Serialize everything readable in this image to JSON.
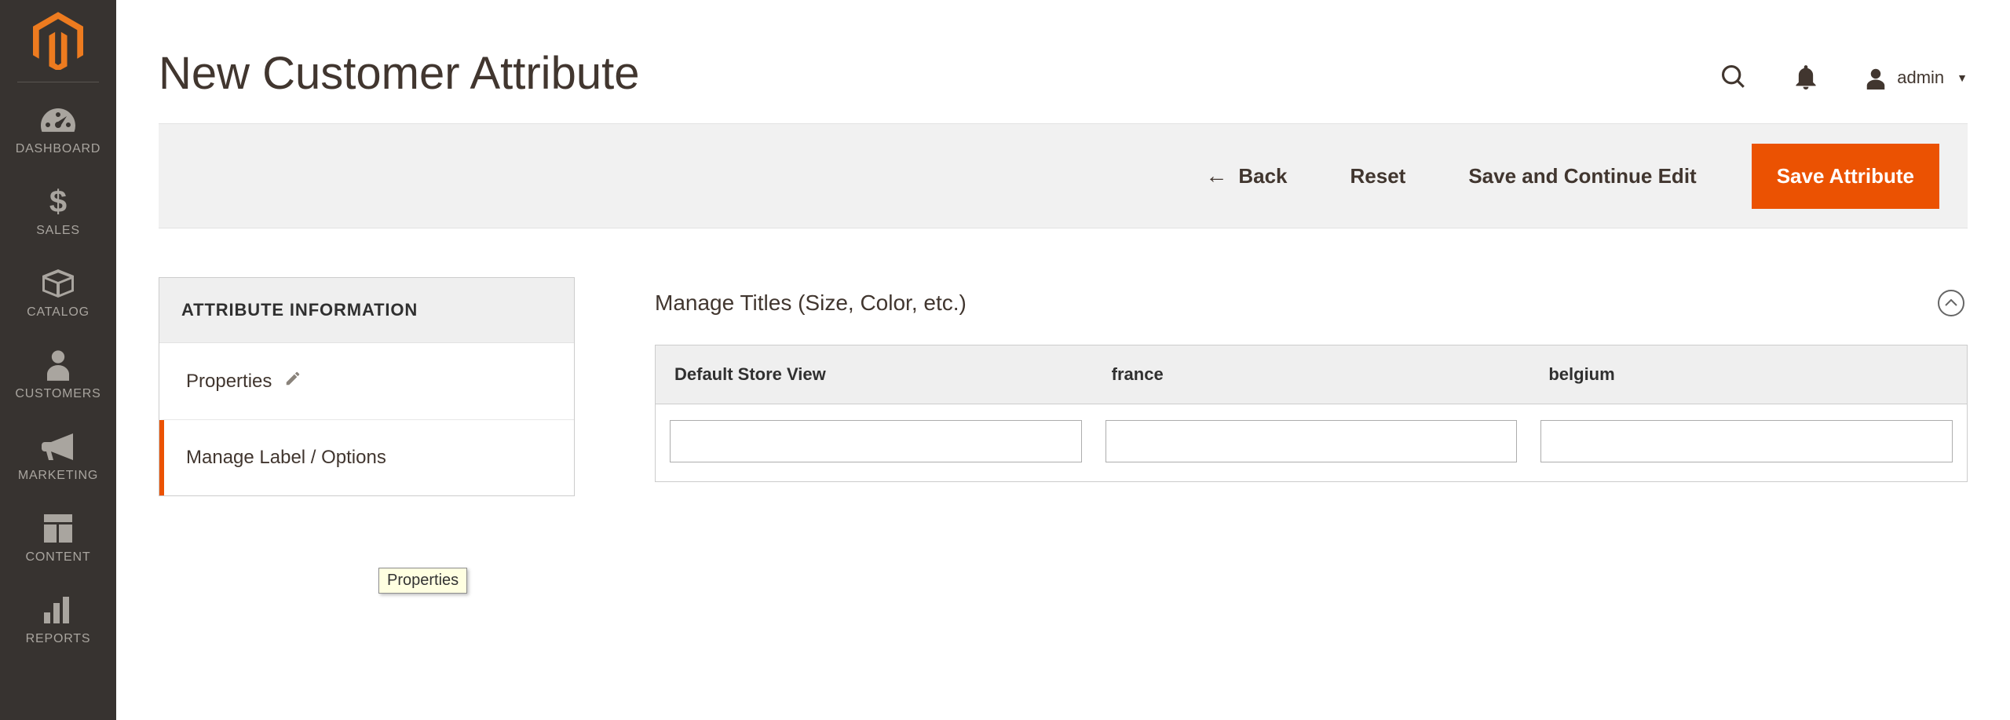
{
  "sidebar": {
    "items": [
      {
        "label": "DASHBOARD"
      },
      {
        "label": "SALES"
      },
      {
        "label": "CATALOG"
      },
      {
        "label": "CUSTOMERS"
      },
      {
        "label": "MARKETING"
      },
      {
        "label": "CONTENT"
      },
      {
        "label": "REPORTS"
      }
    ]
  },
  "header": {
    "title": "New Customer Attribute",
    "admin_name": "admin"
  },
  "actions": {
    "back": "Back",
    "reset": "Reset",
    "save_continue": "Save and Continue Edit",
    "save": "Save Attribute"
  },
  "side_panel": {
    "header": "ATTRIBUTE INFORMATION",
    "tabs": {
      "properties": "Properties",
      "manage_label": "Manage Label / Options"
    },
    "tooltip": "Properties"
  },
  "section": {
    "title": "Manage Titles (Size, Color, etc.)"
  },
  "titles_table": {
    "columns": [
      {
        "label": "Default Store View",
        "value": ""
      },
      {
        "label": "france",
        "value": ""
      },
      {
        "label": "belgium",
        "value": ""
      }
    ]
  }
}
